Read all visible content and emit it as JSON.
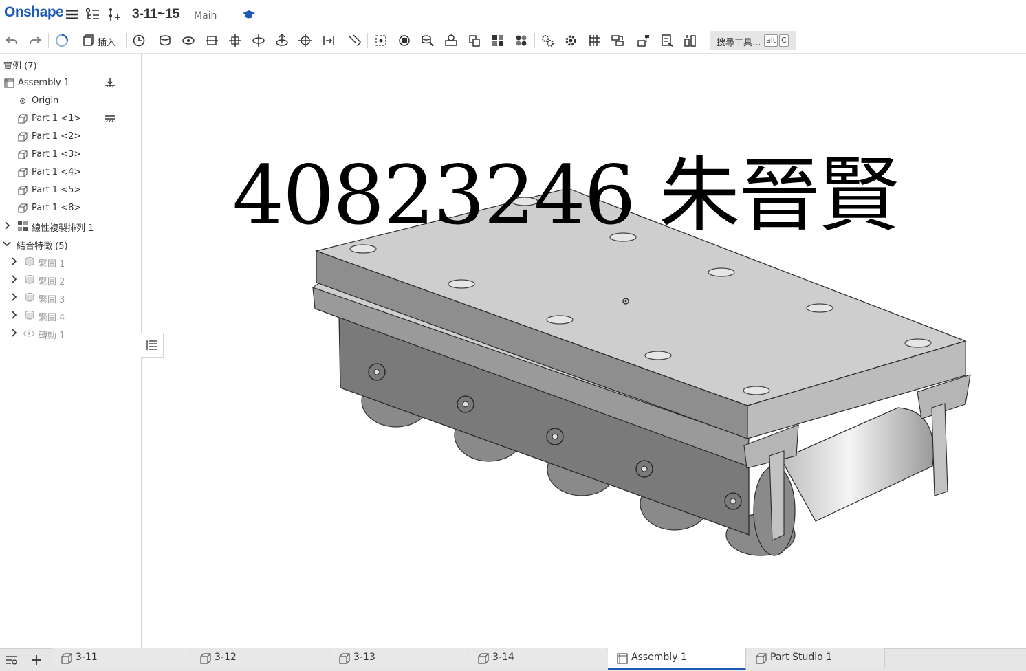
{
  "app": {
    "logo": "Onshape"
  },
  "document": {
    "title": "3-11~15",
    "branch": "Main"
  },
  "toolbar": {
    "insert_label": "插入",
    "search_tools_label": "搜尋工具...",
    "shortcut_key1": "alt",
    "shortcut_key2": "C"
  },
  "tree": {
    "instances_header": "實例 (7)",
    "assembly": "Assembly 1",
    "origin": "Origin",
    "parts": [
      "Part 1 <1>",
      "Part 1 <2>",
      "Part 1 <3>",
      "Part 1 <4>",
      "Part 1 <5>",
      "Part 1 <8>"
    ],
    "pattern": "線性複製排列 1",
    "mates_header": "結合特徵 (5)",
    "mates": [
      "緊固 1",
      "緊固 2",
      "緊固 3",
      "緊固 4",
      "轉動 1"
    ]
  },
  "viewport": {
    "watermark": "40823246 朱晉賢"
  },
  "tabs": [
    "3-11",
    "3-12",
    "3-13",
    "3-14",
    "Assembly 1",
    "Part Studio 1"
  ],
  "active_tab": "Assembly 1",
  "colors": {
    "brand": "#1e5bb8",
    "panel_border": "#d4d4d4",
    "tab_bar": "#e6e6e6"
  }
}
